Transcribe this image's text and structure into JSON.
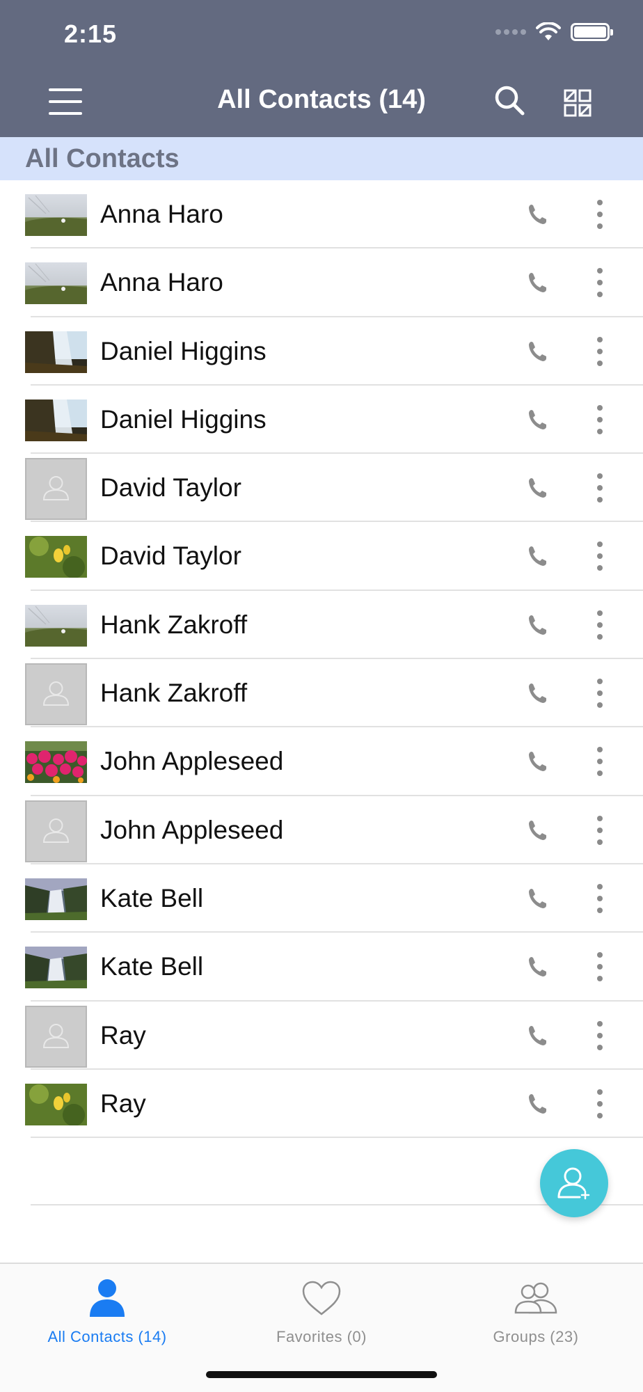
{
  "status_bar": {
    "time": "2:15"
  },
  "nav": {
    "title": "All Contacts (14)"
  },
  "section": {
    "title": "All Contacts"
  },
  "contacts": [
    {
      "name": "Anna Haro",
      "avatar": "photo-grass-sky"
    },
    {
      "name": "Anna Haro",
      "avatar": "photo-grass-sky"
    },
    {
      "name": "Daniel Higgins",
      "avatar": "photo-waterfall-coast"
    },
    {
      "name": "Daniel Higgins",
      "avatar": "photo-waterfall-coast"
    },
    {
      "name": "David Taylor",
      "avatar": "placeholder-person"
    },
    {
      "name": "David Taylor",
      "avatar": "photo-yellow-flower"
    },
    {
      "name": "Hank Zakroff",
      "avatar": "photo-grass-sky"
    },
    {
      "name": "Hank Zakroff",
      "avatar": "placeholder-person"
    },
    {
      "name": "John Appleseed",
      "avatar": "photo-pink-flowers"
    },
    {
      "name": "John Appleseed",
      "avatar": "placeholder-person"
    },
    {
      "name": "Kate Bell",
      "avatar": "photo-waterfall-green"
    },
    {
      "name": "Kate Bell",
      "avatar": "photo-waterfall-green"
    },
    {
      "name": "Ray",
      "avatar": "placeholder-person"
    },
    {
      "name": "Ray",
      "avatar": "photo-yellow-flower"
    }
  ],
  "tabs": [
    {
      "label": "All Contacts (14)",
      "icon": "person-icon",
      "active": true
    },
    {
      "label": "Favorites (0)",
      "icon": "heart-icon",
      "active": false
    },
    {
      "label": "Groups (23)",
      "icon": "group-icon",
      "active": false
    }
  ],
  "colors": {
    "header_bg": "#636a80",
    "section_bg": "#d6e2fb",
    "accent": "#1a7cf2",
    "fab": "#45c8d9"
  }
}
